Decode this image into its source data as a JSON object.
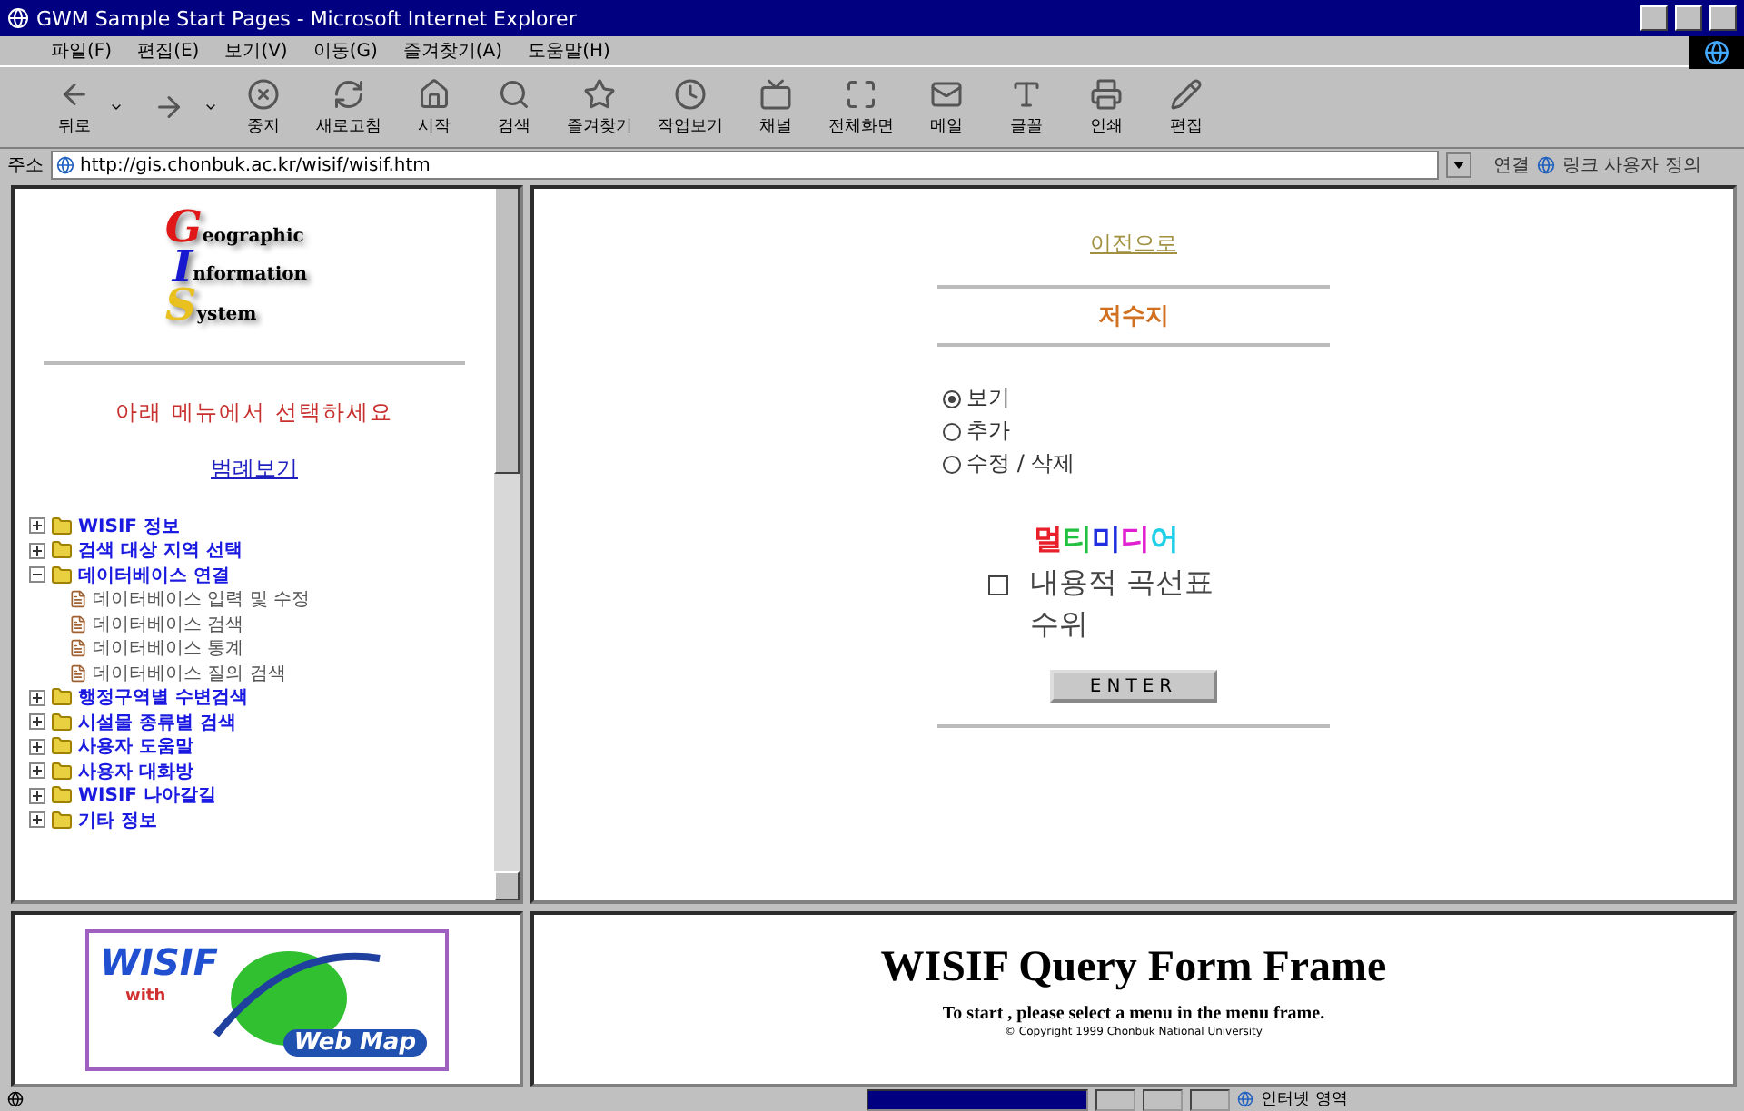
{
  "window": {
    "title": "GWM Sample Start Pages - Microsoft Internet Explorer"
  },
  "menu": [
    "파일(F)",
    "편집(E)",
    "보기(V)",
    "이동(G)",
    "즐겨찾기(A)",
    "도움말(H)"
  ],
  "toolbar": [
    {
      "label": "뒤로",
      "dropdown": true
    },
    {
      "dropdown": true
    },
    {
      "label": "중지",
      "dropdown": false
    },
    {
      "label": "새로고침",
      "dropdown": false
    },
    {
      "label": "시작",
      "dropdown": false
    },
    {
      "label": "검색",
      "dropdown": false
    },
    {
      "label": "즐겨찾기",
      "dropdown": false
    },
    {
      "label": "작업보기",
      "dropdown": false
    },
    {
      "label": "채널",
      "dropdown": false
    },
    {
      "label": "전체화면",
      "dropdown": false
    },
    {
      "label": "메일",
      "dropdown": false
    },
    {
      "label": "글꼴",
      "dropdown": false
    },
    {
      "label": "인쇄",
      "dropdown": false
    },
    {
      "label": "편집",
      "dropdown": false
    }
  ],
  "address": {
    "label": "주소",
    "value": "http://gis.chonbuk.ac.kr/wisif/wisif.htm",
    "links_label": "연결",
    "link": "링크 사용자 정의"
  },
  "left_frame": {
    "logo": [
      "Geographic",
      "Information",
      "System"
    ],
    "prompt": "아래 메뉴에서 선택하세요",
    "legend_link": "범례보기",
    "tree": [
      {
        "label": "WISIF 정보",
        "expanded": false
      },
      {
        "label": "검색 대상 지역 선택",
        "expanded": false
      },
      {
        "label": "데이터베이스 연결",
        "expanded": true,
        "children": [
          {
            "label": "데이터베이스 입력 및 수정"
          },
          {
            "label": "데이터베이스 검색"
          },
          {
            "label": "데이터베이스 통계"
          },
          {
            "label": "데이터베이스 질의 검색"
          }
        ]
      },
      {
        "label": "행정구역별 수변검색",
        "expanded": false
      },
      {
        "label": "시설물 종류별 검색",
        "expanded": false
      },
      {
        "label": "사용자 도움말",
        "expanded": false
      },
      {
        "label": "사용자 대화방",
        "expanded": false
      },
      {
        "label": "WISIF 나아갈길",
        "expanded": false
      },
      {
        "label": "기타 정보",
        "expanded": false
      }
    ]
  },
  "main_frame": {
    "back_link": "이전으로",
    "heading": "저수지",
    "modes": [
      {
        "label": "보기",
        "selected": true
      },
      {
        "label": "추가",
        "selected": false
      },
      {
        "label": "수정 / 삭제",
        "selected": false
      }
    ],
    "multimedia": [
      {
        "text": "멀",
        "color": "#e8202a"
      },
      {
        "text": "티",
        "color": "#20c040"
      },
      {
        "text": "미",
        "color": "#2030e0"
      },
      {
        "text": "디",
        "color": "#e020d0"
      },
      {
        "text": "어",
        "color": "#20d0e8"
      }
    ],
    "curve_option": {
      "label": "내용적 곡선표",
      "sublabel": "수위",
      "checked": false
    },
    "submit": "ENTER"
  },
  "bottom_left": {
    "logo_title": "WISIF",
    "logo_with": "with",
    "logo_sub": "Web Map"
  },
  "bottom_right": {
    "title": "WISIF Query Form Frame",
    "subtitle": "To start , please select a menu in the menu frame.",
    "copyright": "© Copyright 1999 Chonbuk National University"
  },
  "status_bar": {
    "progress": {
      "level": 1
    },
    "zone": "인터넷 영역"
  }
}
